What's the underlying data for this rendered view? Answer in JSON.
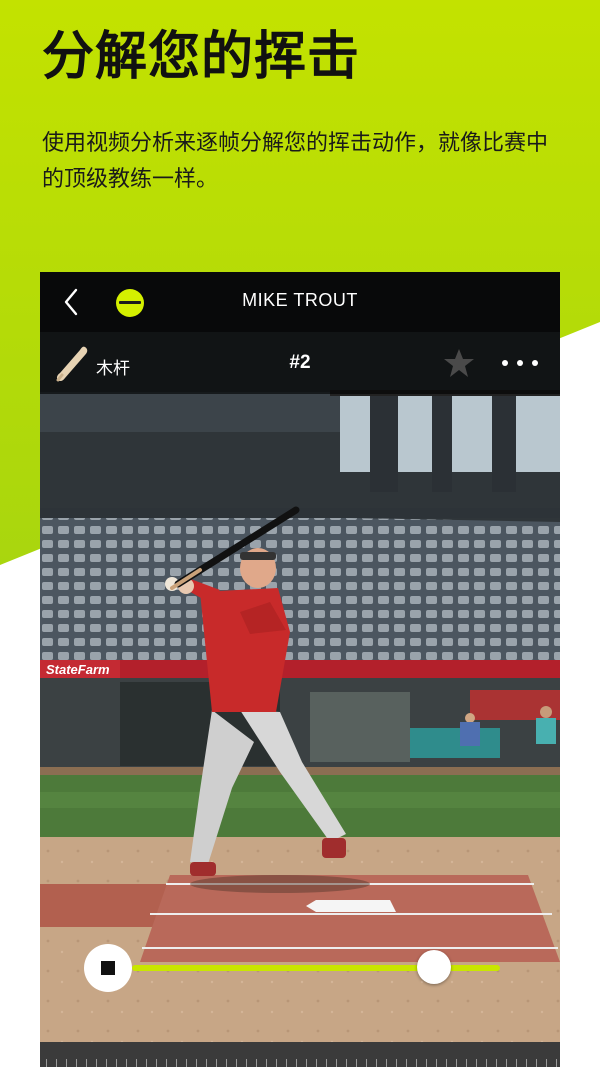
{
  "promo": {
    "headline": "分解您的挥击",
    "subtext": "使用视频分析来逐帧分解您的挥击动作，就像比赛中的顶级教练一样。"
  },
  "player": {
    "topbar": {
      "back_icon": "chevron-left-icon",
      "mode_icon": "baseball-toggle-icon",
      "title": "MIKE TROUT"
    },
    "infobar": {
      "bat_icon": "wood-bat-icon",
      "bat_label": "木杆",
      "swing_number": "#2",
      "favorite_icon": "star-icon",
      "more_icon": "more-dots-icon"
    },
    "playback": {
      "control_icon": "stop-icon",
      "progress": 0.82
    },
    "sign_text": "StateFarm"
  },
  "colors": {
    "accent": "#d4f000",
    "background_top": "#c8e400",
    "background_bottom": "#ffffff"
  }
}
